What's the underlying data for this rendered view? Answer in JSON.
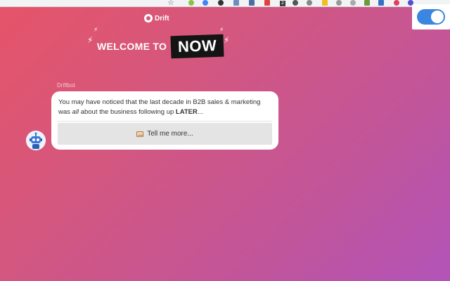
{
  "browser": {
    "extension_icons": [
      "star-icon",
      "ext-icon",
      "ext-icon",
      "ext-icon",
      "ext-icon",
      "ext-icon",
      "ext-icon",
      "ext-icon",
      "ext-icon",
      "ext-icon"
    ],
    "badge_count": "2"
  },
  "toggle": {
    "state": "on",
    "color": "#3a86e0"
  },
  "header": {
    "logo_text": "Drift",
    "welcome_text": "WELCOME TO",
    "highlight_text": "NOW"
  },
  "chat": {
    "bot_name": "Driftbot",
    "message_part1": "You may have noticed that the last decade in B2B sales & marketing was ",
    "message_italic": "all",
    "message_part2": " about the business following up ",
    "message_bold": "LATER",
    "message_part3": "...",
    "button_label": "Tell me more..."
  },
  "colors": {
    "gradient_start": "#e65468",
    "gradient_end": "#b254b8",
    "now_background": "#141414"
  }
}
